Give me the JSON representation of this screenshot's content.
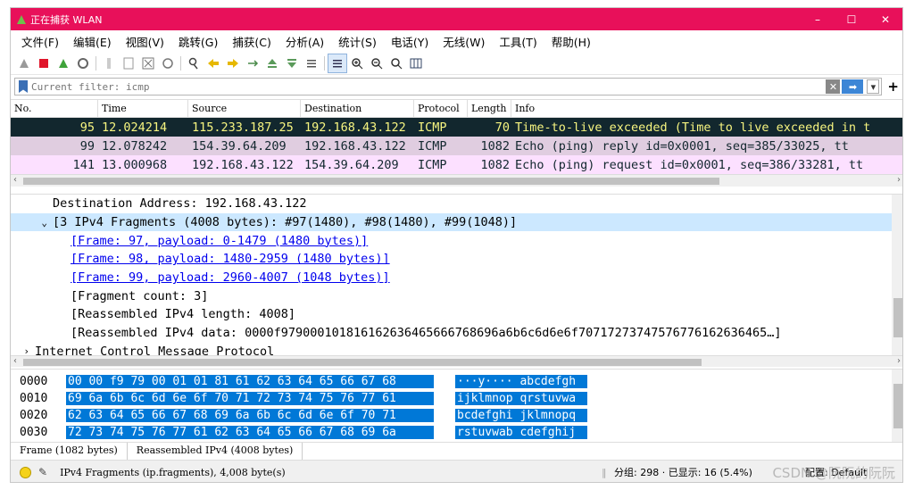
{
  "window": {
    "title": "正在捕获 WLAN",
    "controls": [
      "–",
      "☐",
      "✕"
    ]
  },
  "menu": [
    "文件(F)",
    "编辑(E)",
    "视图(V)",
    "跳转(G)",
    "捕获(C)",
    "分析(A)",
    "统计(S)",
    "电话(Y)",
    "无线(W)",
    "工具(T)",
    "帮助(H)"
  ],
  "filter": {
    "placeholder": "Current filter: icmp",
    "add_label": "+"
  },
  "packet_list": {
    "columns": [
      "No.",
      "Time",
      "Source",
      "Destination",
      "Protocol",
      "Length",
      "Info"
    ],
    "rows": [
      {
        "no": "95",
        "time": "12.024214",
        "src": "115.233.187.25",
        "dst": "192.168.43.122",
        "proto": "ICMP",
        "len": "70",
        "info": "Time-to-live exceeded (Time to live exceeded in t",
        "bg": "#12272e",
        "fg": "#f7f580"
      },
      {
        "no": "99",
        "time": "12.078242",
        "src": "154.39.64.209",
        "dst": "192.168.43.122",
        "proto": "ICMP",
        "len": "1082",
        "info": "Echo (ping) reply    id=0x0001, seq=385/33025, tt",
        "bg": "#e0cde0",
        "fg": "#12272e"
      },
      {
        "no": "141",
        "time": "13.000968",
        "src": "192.168.43.122",
        "dst": "154.39.64.209",
        "proto": "ICMP",
        "len": "1082",
        "info": "Echo (ping) request  id=0x0001, seq=386/33281, tt",
        "bg": "#fce0ff",
        "fg": "#12272e"
      }
    ]
  },
  "details": {
    "dest_addr": "Destination Address: 192.168.43.122",
    "frag_header": "[3 IPv4 Fragments (4008 bytes): #97(1480), #98(1480), #99(1048)]",
    "frame97": "[Frame: 97, payload: 0-1479 (1480 bytes)]",
    "frame98": "[Frame: 98, payload: 1480-2959 (1480 bytes)]",
    "frame99": "[Frame: 99, payload: 2960-4007 (1048 bytes)]",
    "frag_count": "[Fragment count: 3]",
    "reasm_len": "[Reassembled IPv4 length: 4008]",
    "reasm_data": "[Reassembled IPv4 data: 0000f9790001018161626364656667686​96a6b6c6d6e6f7071727374757677616263646​5…]",
    "icmp": "Internet Control Message Protocol"
  },
  "bytes_pane": {
    "lines": [
      {
        "off": "0000",
        "hex": "00 00 f9 79 00 01 01 81  61 62 63 64 65 66 67 68",
        "ascii": "···y···· abcdefgh"
      },
      {
        "off": "0010",
        "hex": "69 6a 6b 6c 6d 6e 6f 70  71 72 73 74 75 76 77 61",
        "ascii": "ijklmnop qrstuvwa"
      },
      {
        "off": "0020",
        "hex": "62 63 64 65 66 67 68 69  6a 6b 6c 6d 6e 6f 70 71",
        "ascii": "bcdefghi jklmnopq"
      },
      {
        "off": "0030",
        "hex": "72 73 74 75 76 77 61 62  63 64 65 66 67 68 69 6a",
        "ascii": "rstuvwab cdefghij"
      }
    ],
    "tabs": [
      "Frame (1082 bytes)",
      "Reassembled IPv4 (4008 bytes)"
    ]
  },
  "status": {
    "text": "IPv4 Fragments (ip.fragments), 4,008 byte(s)",
    "packets": "分组: 298 · 已显示: 16 (5.4%)",
    "profile": "配置: Default"
  },
  "watermark": "CSDN @阮阮的阮阮"
}
